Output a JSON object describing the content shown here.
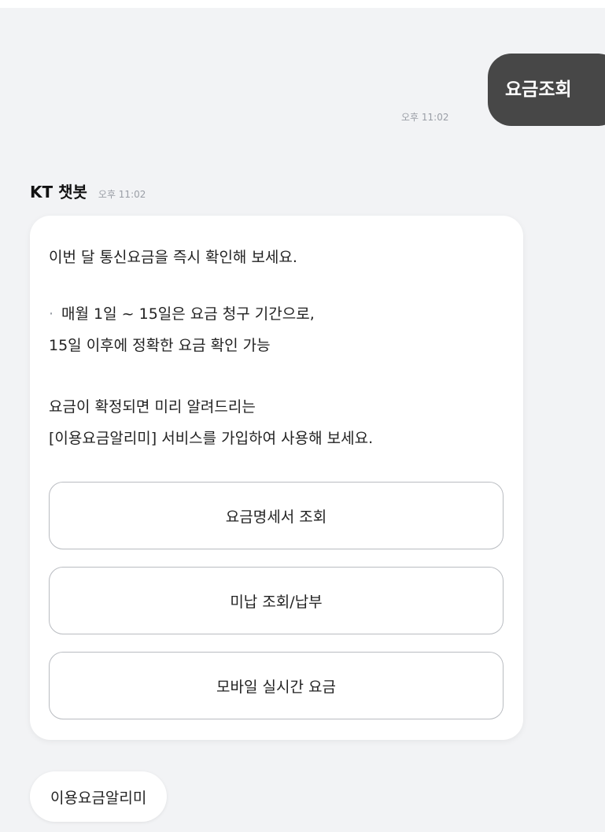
{
  "conversation": {
    "user_message": {
      "text": "요금조회",
      "time": "오후 11:02"
    },
    "bot": {
      "name": "KT 챗봇",
      "time": "오후 11:02",
      "lines": [
        "이번 달 통신요금을 즉시 확인해 보세요.",
        "매월 1일 ~ 15일은 요금 청구 기간으로,",
        "15일 이후에 정확한 요금 확인 가능",
        "요금이 확정되면 미리 알려드리는",
        "[이용요금알리미] 서비스를 가입하여 사용해 보세요."
      ],
      "bullet": "·",
      "buttons": [
        "요금명세서 조회",
        "미납 조회/납부",
        "모바일 실시간 요금"
      ]
    },
    "quick_replies": [
      "이용요금알리미"
    ]
  },
  "colors": {
    "background": "#f2f3f5",
    "user_bubble": "#474747",
    "card": "#ffffff",
    "button_border": "#b9bcc1",
    "timestamp": "#9a9ea6"
  }
}
